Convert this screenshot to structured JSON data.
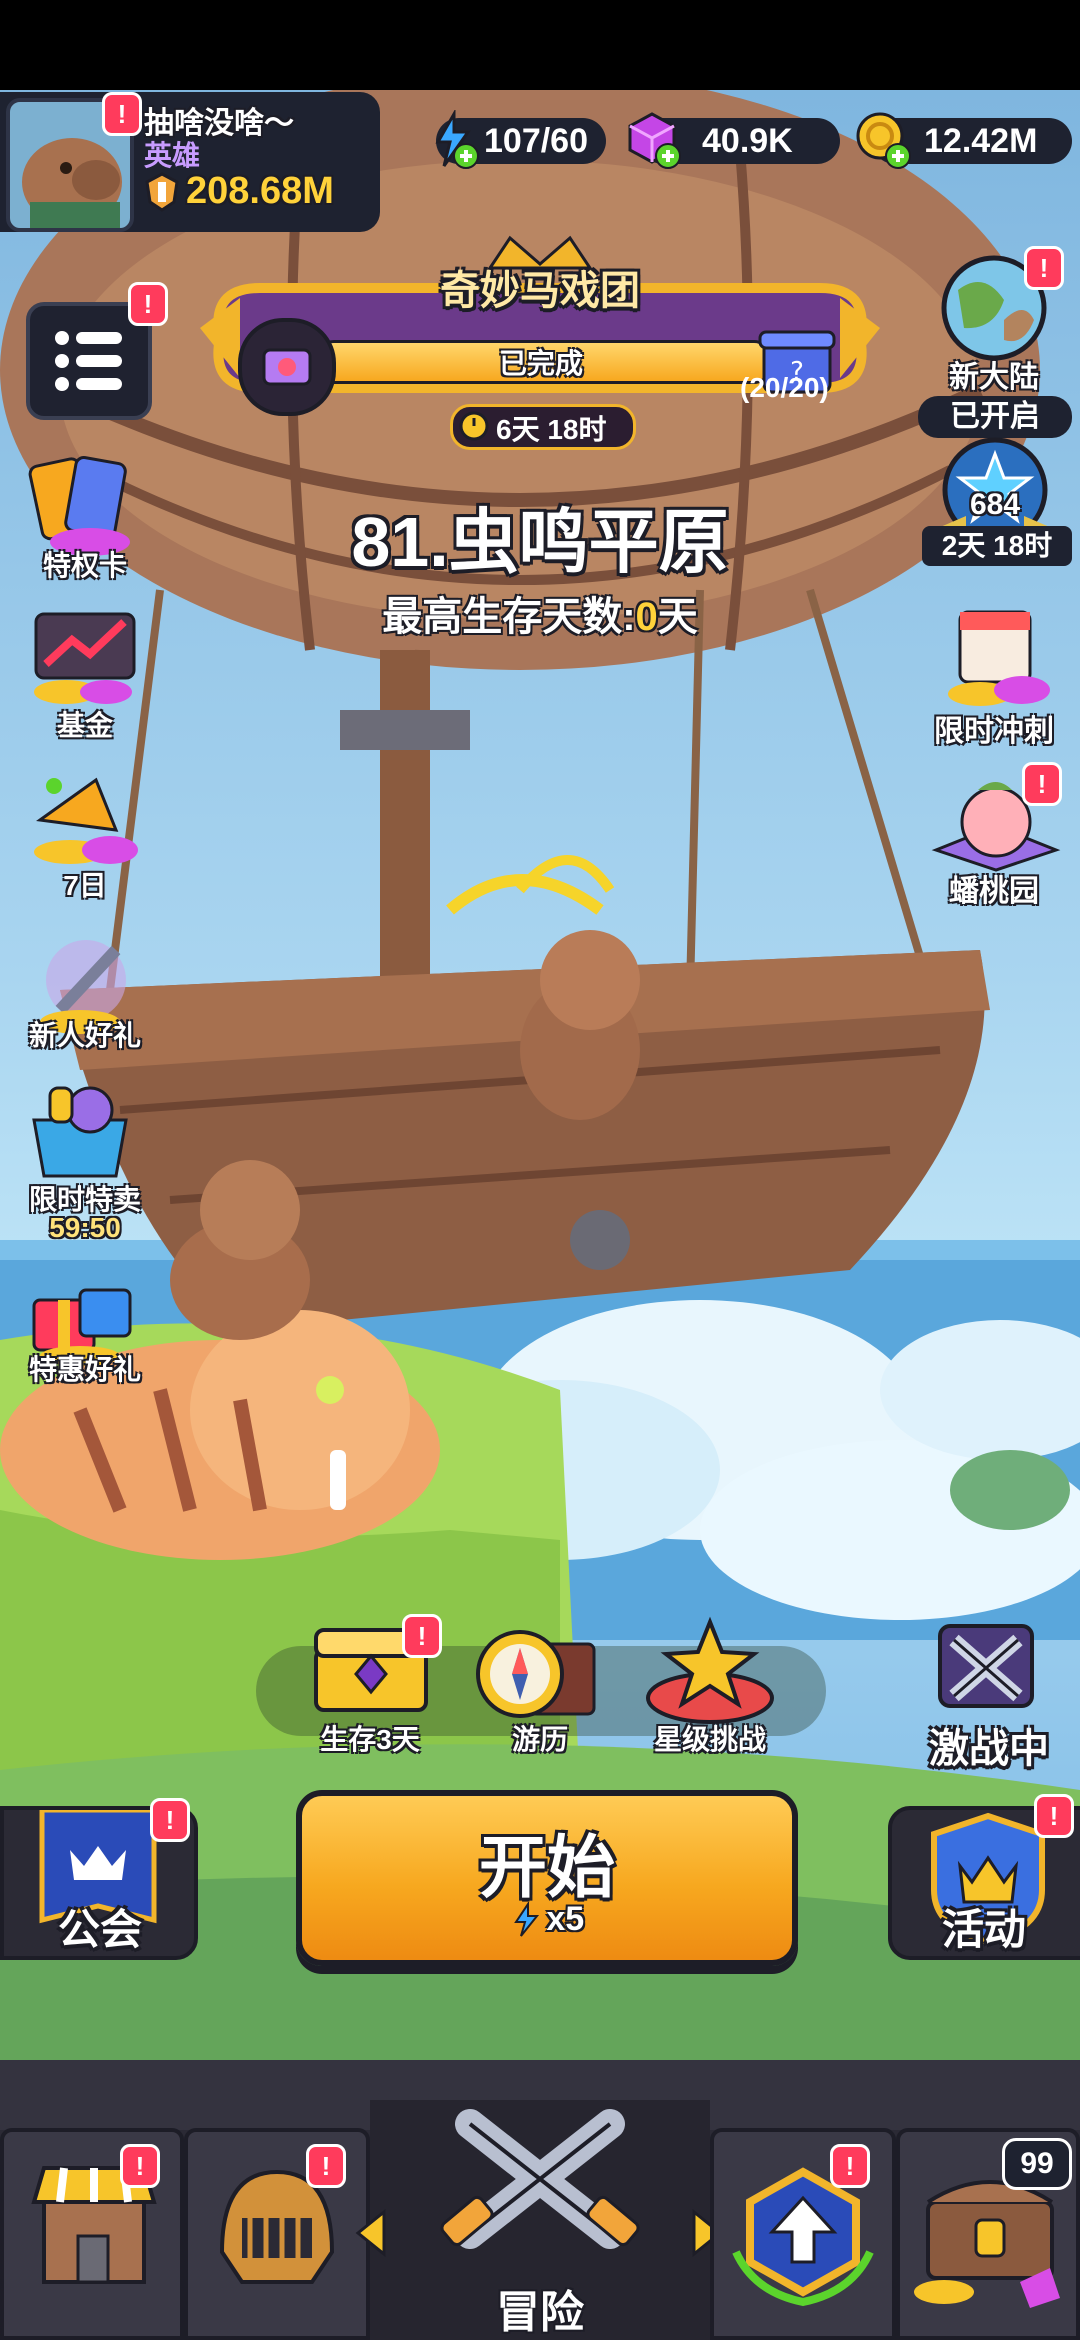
{
  "profile": {
    "name": "抽啥没啥～",
    "title": "英雄",
    "power": "208.68M",
    "badge": "!"
  },
  "resources": {
    "energy": "107/60",
    "gems": "40.9K",
    "gold": "12.42M"
  },
  "event_banner": {
    "title": "奇妙马戏团",
    "status": "已完成",
    "progress_text": "(20/20)",
    "progress": 1.0,
    "timer": "6天 18时"
  },
  "stage": {
    "name": "81.虫鸣平原",
    "best_label": "最高生存天数:",
    "best_value": "0",
    "best_unit": "天"
  },
  "left_menu": [
    {
      "label": "特权卡",
      "icon": "privilege-card-icon"
    },
    {
      "label": "基金",
      "icon": "fund-chart-icon"
    },
    {
      "label": "7日",
      "icon": "seven-day-gift-icon"
    },
    {
      "label": "新人好礼",
      "icon": "newbie-gift-icon"
    },
    {
      "label": "限时特卖",
      "sub": "59:50",
      "icon": "flash-sale-icon"
    },
    {
      "label": "特惠好礼",
      "icon": "special-gift-icon"
    }
  ],
  "right_menu": {
    "new_land_label": "新大陆",
    "new_land_status": "已开启",
    "star_count": "684",
    "star_timer": "2天 18时",
    "sprint_label": "限时冲刺",
    "peach_label": "蟠桃园",
    "battle_label": "激战中"
  },
  "mode_buttons": [
    {
      "label": "生存3天",
      "icon": "treasure-chest-icon"
    },
    {
      "label": "游历",
      "icon": "compass-icon"
    },
    {
      "label": "星级挑战",
      "icon": "star-challenge-icon"
    }
  ],
  "start_button": {
    "label": "开始",
    "cost": "x5"
  },
  "guild_label": "公会",
  "activity_label": "活动",
  "bottom_nav": {
    "center_label": "冒险",
    "chest_count": "99"
  },
  "colors": {
    "accent_orange": "#f7a81f",
    "badge_red": "#ff3b5c",
    "gold_text": "#ffd23a",
    "nav_bg": "#2b2a35"
  }
}
